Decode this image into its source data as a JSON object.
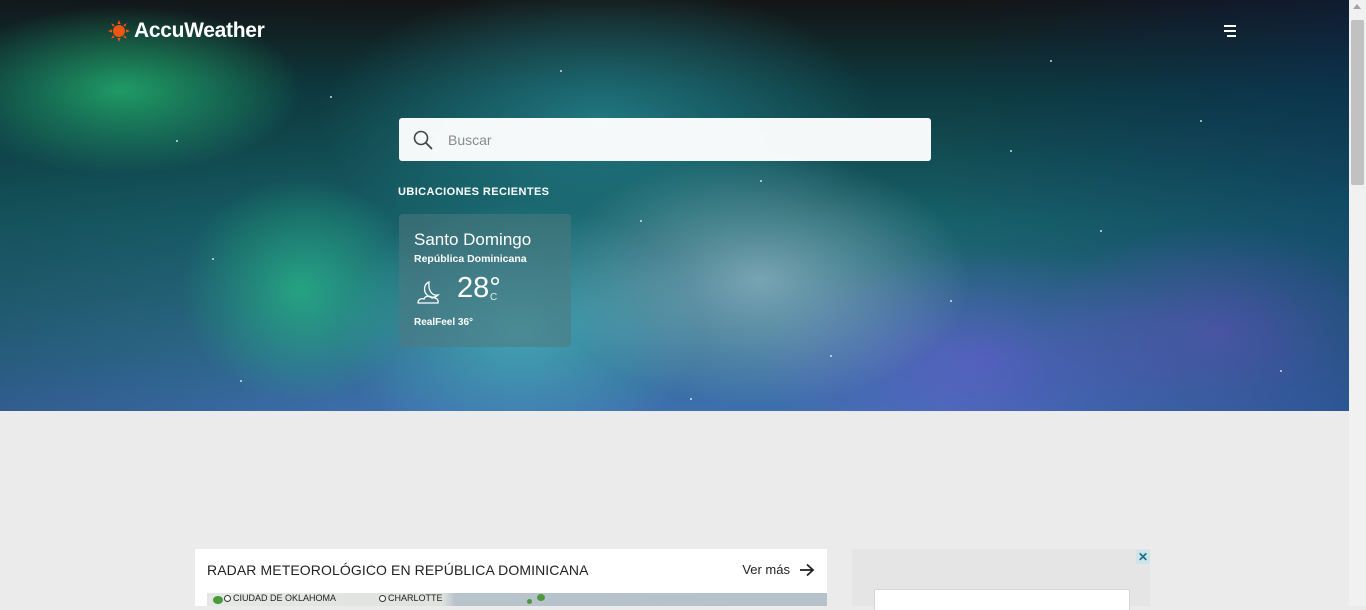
{
  "header": {
    "logo_text": "AccuWeather",
    "logo_icon": "sun-icon",
    "menu_icon": "hamburger-menu-icon"
  },
  "search": {
    "placeholder": "Buscar",
    "icon": "search-icon"
  },
  "recent_locations": {
    "title": "UBICACIONES RECIENTES",
    "items": [
      {
        "city": "Santo Domingo",
        "country": "República Dominicana",
        "icon": "moon-clouds-icon",
        "temperature": "28°",
        "unit": "C",
        "realfeel": "RealFeel 36°"
      }
    ]
  },
  "radar": {
    "title": "RADAR METEOROLÓGICO EN REPÚBLICA DOMINICANA",
    "see_more": "Ver más",
    "map_labels": [
      "CIUDAD DE OKLAHOMA",
      "CHARLOTTE"
    ]
  },
  "ad": {
    "close_label": "✕"
  },
  "colors": {
    "brand_orange": "#f05514",
    "background": "#ebebeb"
  }
}
